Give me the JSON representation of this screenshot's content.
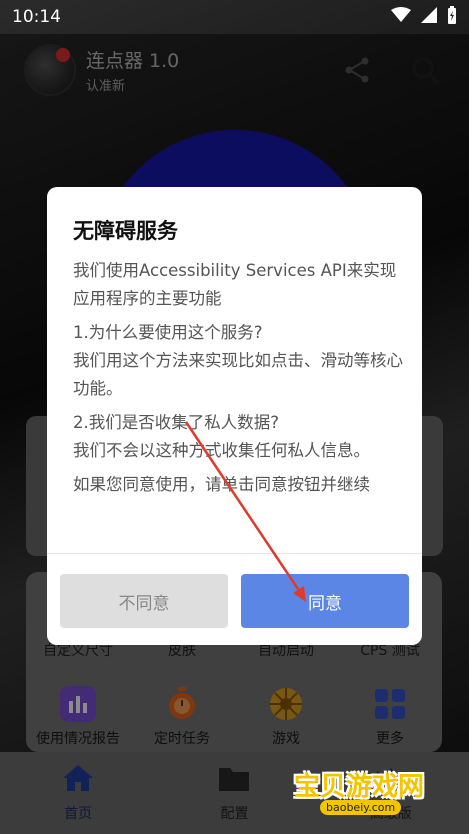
{
  "status_bar": {
    "time": "10:14"
  },
  "header": {
    "title": "连点器 1.0",
    "subtitle": "认准新"
  },
  "dialog": {
    "title": "无障碍服务",
    "paragraphs": [
      "我们使用Accessibility Services API来实现应用程序的主要功能",
      "1.为什么要使用这个服务?\n我们用这个方法来实现比如点击、滑动等核心功能。",
      "2.我们是否收集了私人数据?\n我们不会以这种方式收集任何私人信息。",
      "如果您同意使用，请单击同意按钮并继续"
    ],
    "disagree_label": "不同意",
    "agree_label": "同意"
  },
  "grid": {
    "top_labels": [
      "自定义尺寸",
      "皮肤",
      "自动启动",
      "CPS 测试"
    ],
    "items": [
      {
        "label": "使用情况报告",
        "icon": "bar-chart-icon",
        "color": "#7b4fd6"
      },
      {
        "label": "定时任务",
        "icon": "stopwatch-icon",
        "color": "#e8651a"
      },
      {
        "label": "游戏",
        "icon": "game-wheel-icon",
        "color": "#e0a020"
      },
      {
        "label": "更多",
        "icon": "grid-more-icon",
        "color": "#3355cc"
      }
    ]
  },
  "bottom_nav": [
    {
      "label": "首页",
      "icon": "home-icon"
    },
    {
      "label": "配置",
      "icon": "folder-icon"
    },
    {
      "label": "高级版",
      "icon": "crown-icon"
    }
  ],
  "watermark": {
    "text": "宝贝游戏网",
    "url": "baobeiy.com"
  },
  "colors": {
    "accent": "#5b86e5",
    "disagree_bg": "#dedede",
    "arrow": "#e03a2a"
  }
}
